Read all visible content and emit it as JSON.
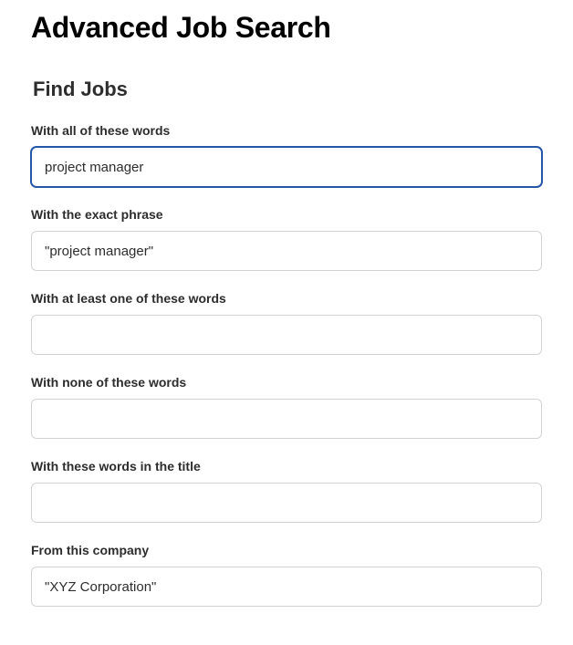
{
  "page": {
    "title": "Advanced Job Search",
    "subtitle": "Find Jobs"
  },
  "form": {
    "all_words": {
      "label": "With all of these words",
      "value": "project manager"
    },
    "exact_phrase": {
      "label": "With the exact phrase",
      "value": "\"project manager\""
    },
    "at_least_one": {
      "label": "With at least one of these words",
      "value": ""
    },
    "none_of_these": {
      "label": "With none of these words",
      "value": ""
    },
    "in_title": {
      "label": "With these words in the title",
      "value": ""
    },
    "company": {
      "label": "From this company",
      "value": "\"XYZ Corporation\""
    }
  }
}
